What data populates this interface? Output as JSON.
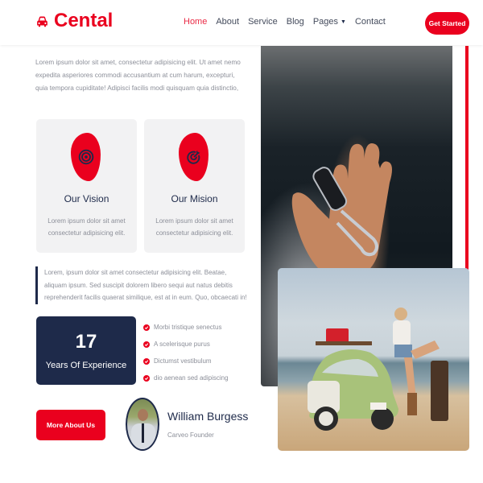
{
  "header": {
    "brand": "Cental",
    "brand_icon": "car-icon",
    "nav": [
      {
        "label": "Home",
        "active": true
      },
      {
        "label": "About"
      },
      {
        "label": "Service"
      },
      {
        "label": "Blog"
      },
      {
        "label": "Pages",
        "has_dropdown": true
      },
      {
        "label": "Contact"
      }
    ],
    "cta_label": "Get Started"
  },
  "about": {
    "intro": "Lorem ipsum dolor sit amet, consectetur adipisicing elit. Ut amet nemo expedita asperiores commodi accusantium at cum harum, excepturi, quia tempora cupiditate! Adipisci facilis modi quisquam quia distinctio,",
    "cards": [
      {
        "title": "Our Vision",
        "icon": "bullseye-icon",
        "text": "Lorem ipsum dolor sit amet consectetur adipisicing elit."
      },
      {
        "title": "Our Mision",
        "icon": "target-arrow-icon",
        "text": "Lorem ipsum dolor sit amet consectetur adipisicing elit."
      }
    ],
    "quote": "Lorem, ipsum dolor sit amet consectetur adipisicing elit. Beatae, aliquam ipsum. Sed suscipit dolorem libero sequi aut natus debitis reprehenderit facilis quaerat similique, est at in eum. Quo, obcaecati in!",
    "experience": {
      "number": "17",
      "label": "Years Of Experience"
    },
    "checklist": [
      "Morbi tristique senectus",
      "A scelerisque purus",
      "Dictumst vestibulum",
      "dio aenean sed adipiscing"
    ],
    "more_button": "More About Us",
    "founder": {
      "name": "William Burgess",
      "role": "Carveo Founder"
    }
  },
  "colors": {
    "accent": "#ea001e",
    "navy": "#1e2a4a",
    "muted": "#8c8f99"
  }
}
